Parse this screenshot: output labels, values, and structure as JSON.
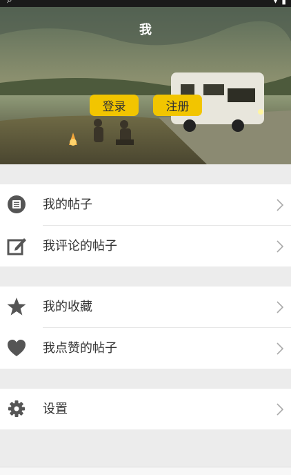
{
  "header": {
    "title": "我",
    "login_label": "登录",
    "register_label": "注册"
  },
  "menu_groups": [
    {
      "items": [
        {
          "label": "我的帖子",
          "icon": "list-icon"
        },
        {
          "label": "我评论的帖子",
          "icon": "edit-icon"
        }
      ]
    },
    {
      "items": [
        {
          "label": "我的收藏",
          "icon": "star-icon"
        },
        {
          "label": "我点赞的帖子",
          "icon": "heart-icon"
        }
      ]
    },
    {
      "items": [
        {
          "label": "设置",
          "icon": "gear-icon"
        }
      ]
    }
  ],
  "colors": {
    "accent": "#f2c500",
    "icon": "#555555",
    "background": "#ececec"
  }
}
